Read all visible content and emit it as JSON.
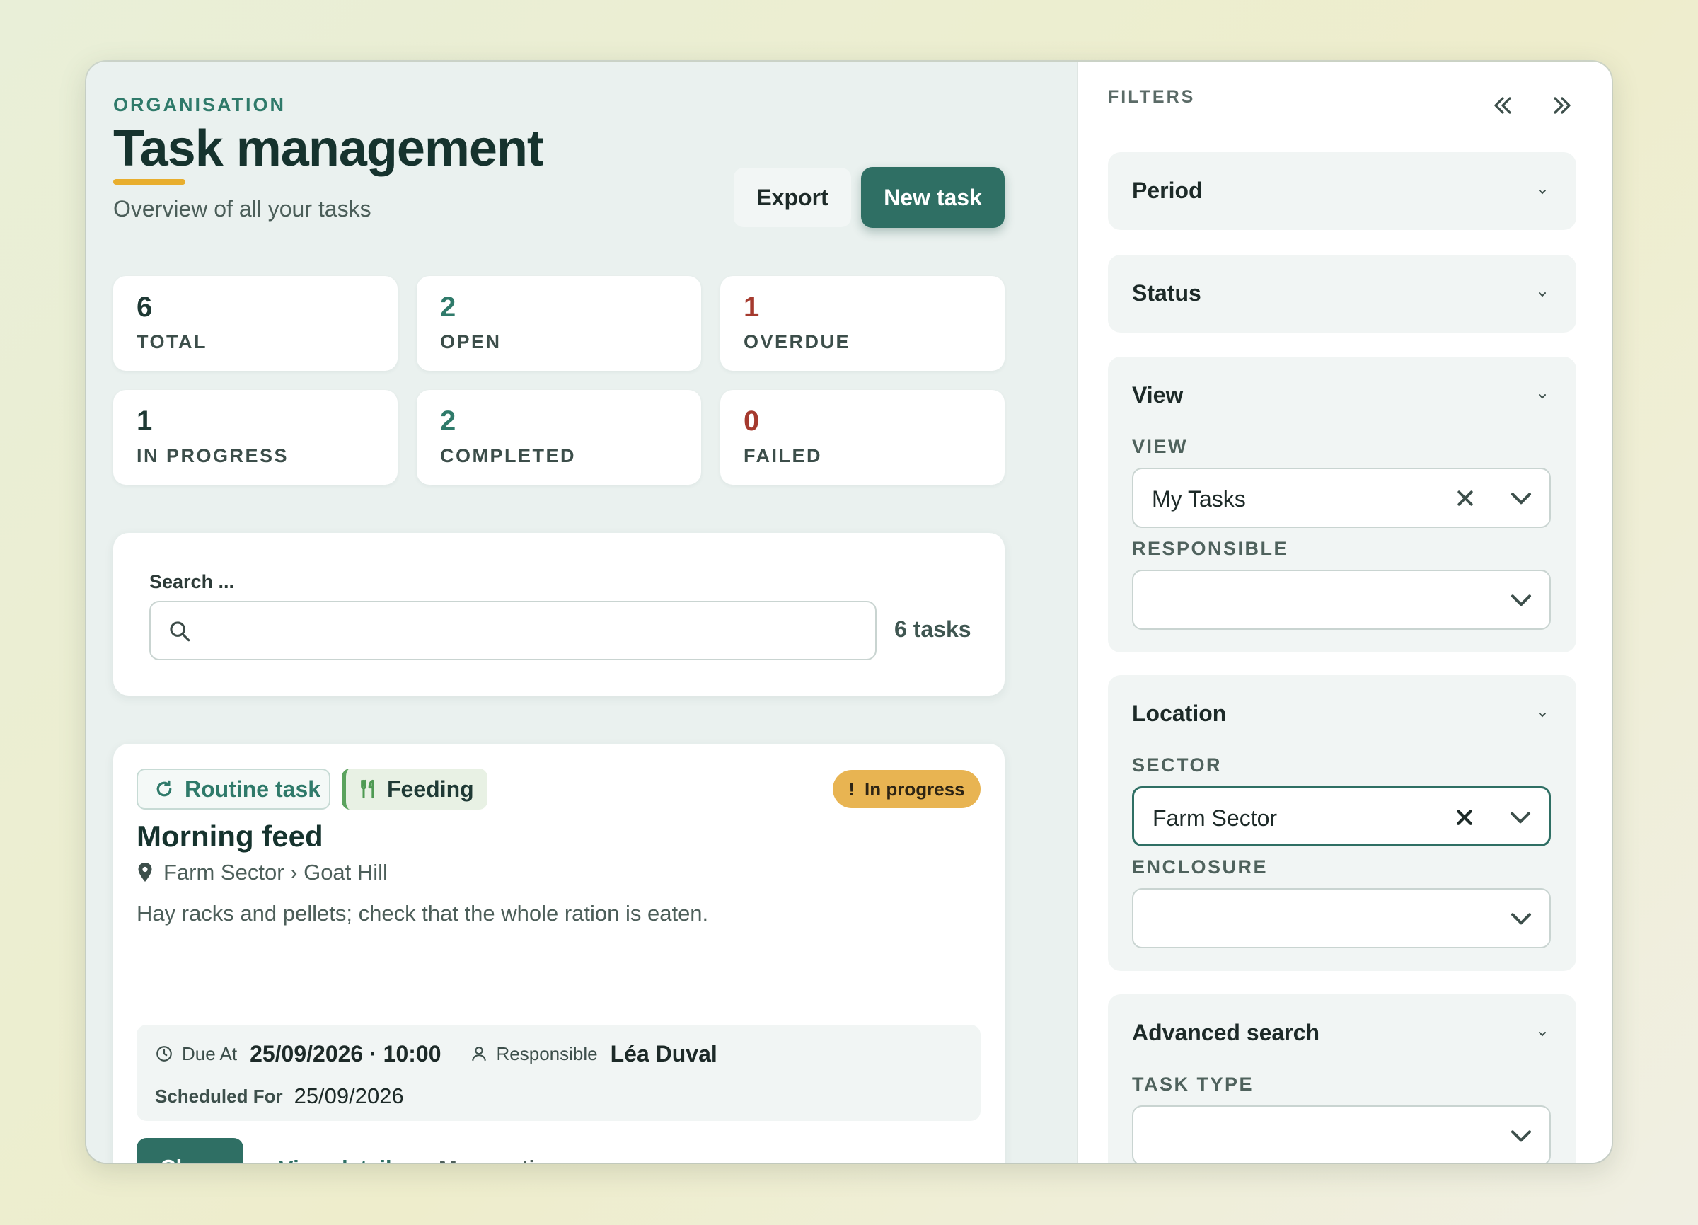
{
  "header": {
    "eyebrow": "ORGANISATION",
    "title": "Task management",
    "subtitle": "Overview of all your tasks",
    "export_label": "Export",
    "new_task_label": "New task"
  },
  "stats": [
    {
      "value": "6",
      "label": "TOTAL",
      "color": "#1e3934"
    },
    {
      "value": "2",
      "label": "OPEN",
      "color": "#2f7a6a"
    },
    {
      "value": "1",
      "label": "OVERDUE",
      "color": "#a53a2e"
    },
    {
      "value": "1",
      "label": "IN PROGRESS",
      "color": "#1e3934"
    },
    {
      "value": "2",
      "label": "COMPLETED",
      "color": "#2f7a6a"
    },
    {
      "value": "0",
      "label": "FAILED",
      "color": "#a53a2e"
    }
  ],
  "search": {
    "label": "Search ...",
    "value": "",
    "placeholder": "",
    "icon": "search-icon",
    "count": "6 tasks"
  },
  "task": {
    "chip_routine": "Routine task",
    "chip_feeding": "Feeding",
    "status_badge": "In progress",
    "title": "Morning feed",
    "location": "Farm Sector › Goat Hill",
    "description": "Hay racks and pellets; check that the whole ration is eaten.",
    "due_label": "Due At",
    "due_value": "25/09/2026 · 10:00",
    "responsible_label": "Responsible",
    "responsible_value": "Léa Duval",
    "scheduled_label": "Scheduled For",
    "scheduled_value": "25/09/2026",
    "close_label": "Close",
    "view_details_label": "View details",
    "more_actions_label": "More actions",
    "colors": {
      "primary": "#2f6f64",
      "badge": "#e8b452",
      "feeding": "#5ba35e"
    }
  },
  "filters": {
    "title": "FILTERS",
    "period": {
      "title": "Period"
    },
    "status": {
      "title": "Status"
    },
    "view": {
      "title": "View",
      "view_label": "VIEW",
      "view_value": "My Tasks",
      "responsible_label": "RESPONSIBLE",
      "responsible_value": ""
    },
    "location": {
      "title": "Location",
      "sector_label": "SECTOR",
      "sector_value": "Farm Sector",
      "enclosure_label": "ENCLOSURE",
      "enclosure_value": ""
    },
    "advanced": {
      "title": "Advanced search",
      "task_type_label": "TASK TYPE",
      "task_type_value": ""
    }
  }
}
